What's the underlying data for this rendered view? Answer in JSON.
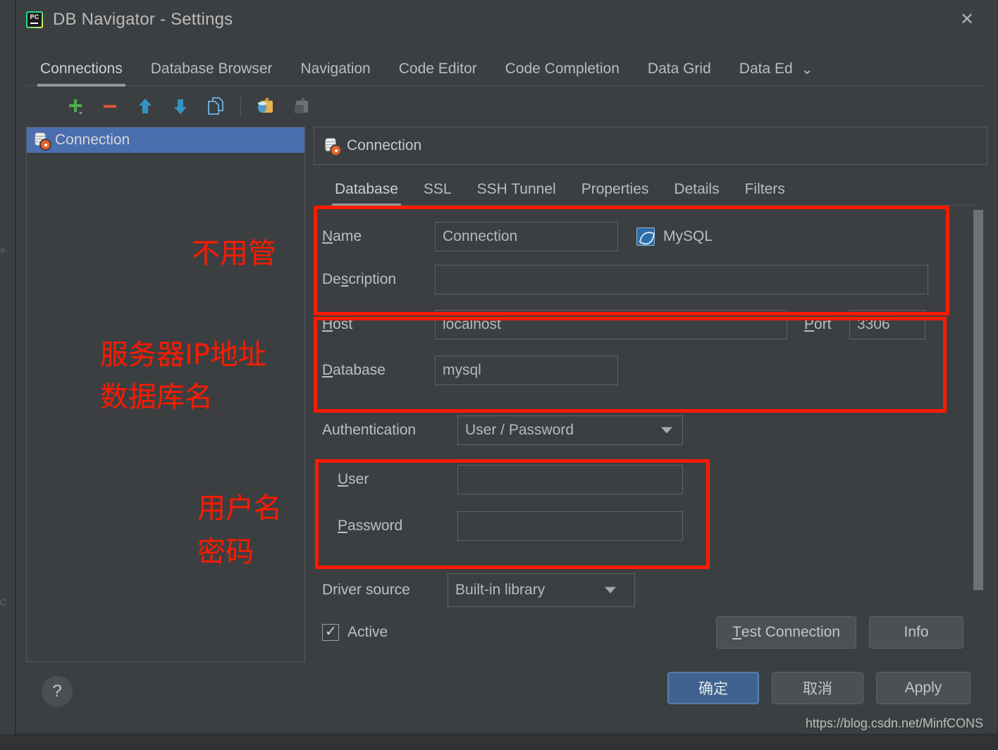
{
  "window": {
    "title": "DB Navigator - Settings",
    "app_icon": "pycharm-icon",
    "app_icon_text": "PC",
    "close_icon": "✕"
  },
  "tabs": {
    "items": [
      {
        "label": "Connections",
        "active": true
      },
      {
        "label": "Database Browser",
        "active": false
      },
      {
        "label": "Navigation",
        "active": false
      },
      {
        "label": "Code Editor",
        "active": false
      },
      {
        "label": "Code Completion",
        "active": false
      },
      {
        "label": "Data Grid",
        "active": false
      },
      {
        "label": "Data Editor",
        "active": false,
        "clipped": true
      }
    ],
    "overflow_icon": "⌄"
  },
  "toolbar": {
    "buttons": [
      {
        "name": "add-connection",
        "icon": "plus-icon"
      },
      {
        "name": "remove-connection",
        "icon": "minus-icon"
      },
      {
        "name": "move-up",
        "icon": "arrow-up-icon"
      },
      {
        "name": "move-down",
        "icon": "arrow-down-icon"
      },
      {
        "name": "duplicate-connection",
        "icon": "copy-icon"
      },
      {
        "name": "paste-connection",
        "icon": "paste-database-icon"
      },
      {
        "name": "import-connection",
        "icon": "import-icon"
      }
    ]
  },
  "connection_list": {
    "items": [
      {
        "label": "Connection",
        "icon": "database-settings-icon",
        "selected": true
      }
    ]
  },
  "detail": {
    "header_title": "Connection",
    "header_icon": "database-settings-icon",
    "subtabs": [
      {
        "label": "Database",
        "active": true
      },
      {
        "label": "SSL",
        "active": false
      },
      {
        "label": "SSH Tunnel",
        "active": false
      },
      {
        "label": "Properties",
        "active": false
      },
      {
        "label": "Details",
        "active": false
      },
      {
        "label": "Filters",
        "active": false
      }
    ],
    "fields": {
      "name_label": "Name",
      "name_mnemonic": "N",
      "name_value": "Connection",
      "db_type_label": "MySQL",
      "db_type_icon": "mysql-icon",
      "description_label_a": "De",
      "description_mnemonic": "s",
      "description_label_b": "cription",
      "description_value": "",
      "host_label": "Host",
      "host_mnemonic": "H",
      "host_value": "localhost",
      "port_label": "Port",
      "port_mnemonic": "P",
      "port_value": "3306",
      "database_label": "atabase",
      "database_mnemonic": "D",
      "database_value": "mysql",
      "authentication_label": "Authentication",
      "authentication_value": "User / Password",
      "user_label": "ser",
      "user_mnemonic": "U",
      "user_value": "",
      "password_label": "assword",
      "password_mnemonic": "P",
      "password_value": "",
      "driver_source_label": "Driver source",
      "driver_source_value": "Built-in library",
      "active_label": "Active",
      "active_checked": true
    },
    "actions": {
      "test_connection_mnemonic": "T",
      "test_connection_label": "est Connection",
      "info_label": "Info"
    }
  },
  "annotations": [
    {
      "text": "不用管",
      "name": "annotation-no-need-to-manage"
    },
    {
      "text": "服务器IP地址",
      "name": "annotation-server-ip-address"
    },
    {
      "text": "数据库名",
      "name": "annotation-database-name"
    },
    {
      "text": "用户名",
      "name": "annotation-username"
    },
    {
      "text": "密码",
      "name": "annotation-password"
    }
  ],
  "footer": {
    "help_label": "?",
    "ok_label": "确定",
    "cancel_label": "取消",
    "apply_label": "Apply",
    "watermark": "https://blog.csdn.net/MinfCONS"
  },
  "colors": {
    "dialog_bg": "#3c3f41",
    "selection_blue": "#4b6eaf",
    "annotation_red": "#ff1a00",
    "primary_button": "#3f628f",
    "border": "#5e6366"
  }
}
